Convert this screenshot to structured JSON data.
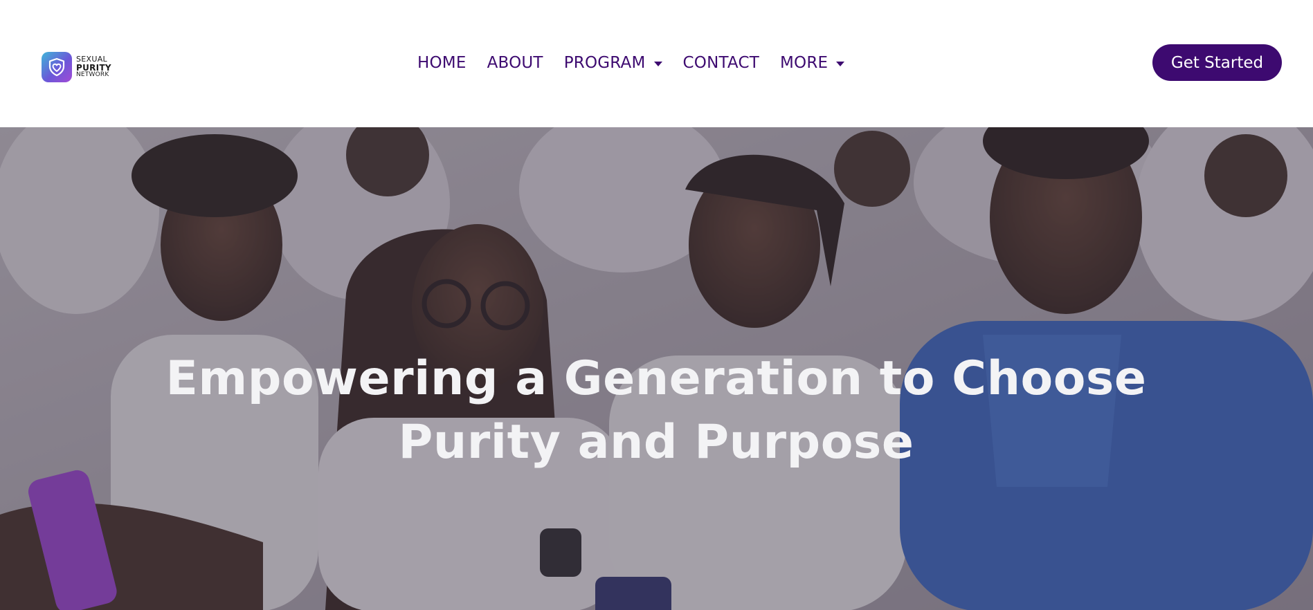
{
  "logo": {
    "line1": "SEXUAL",
    "line2": "PURITY",
    "line3": "NETWORK",
    "icon": "heart-shield-icon"
  },
  "nav": {
    "items": [
      {
        "label": "HOME"
      },
      {
        "label": "ABOUT"
      },
      {
        "label": "PROGRAM",
        "dropdown": true
      },
      {
        "label": "CONTACT"
      },
      {
        "label": "MORE",
        "dropdown": true
      }
    ]
  },
  "cta": {
    "label": "Get Started"
  },
  "hero": {
    "title": "Empowering a Generation to Choose Purity and Purpose"
  },
  "colors": {
    "brand": "#3d0a70",
    "hero_text": "#f3f3f5",
    "logo_gradient_start": "#3fb6d9",
    "logo_gradient_end": "#a24ad6"
  }
}
